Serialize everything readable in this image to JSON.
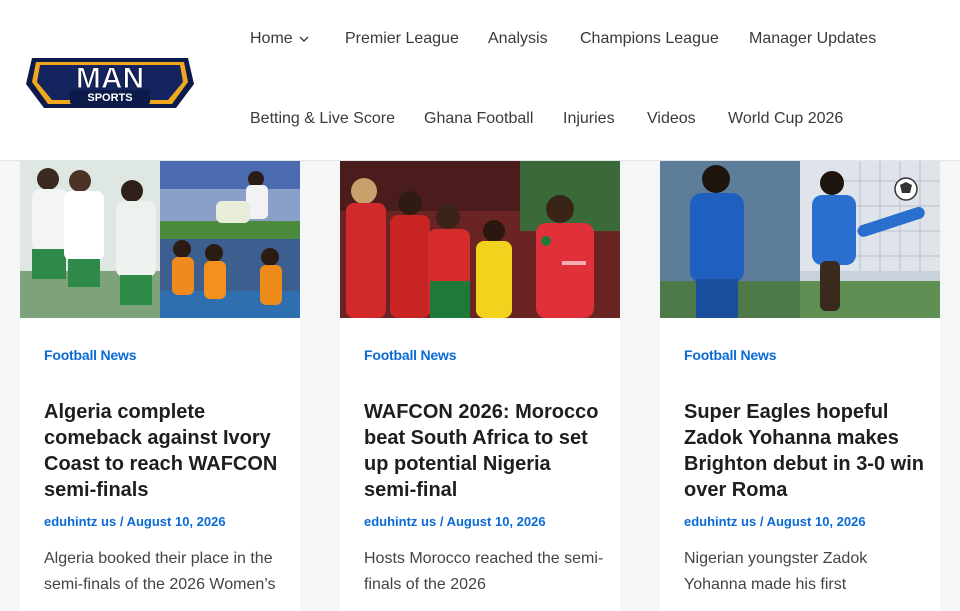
{
  "logo": {
    "main": "MAN",
    "sub": "SPORTS"
  },
  "nav": {
    "home": "Home",
    "premier_league": "Premier League",
    "analysis": "Analysis",
    "champions_league": "Champions League",
    "manager_updates": "Manager Updates",
    "betting": "Betting & Live Score",
    "ghana_football": "Ghana Football",
    "injuries": "Injuries",
    "videos": "Videos",
    "world_cup": "World Cup 2026"
  },
  "colors": {
    "accent": "#0a6bd6",
    "nav_text": "#3a3a3a"
  },
  "posts": [
    {
      "category": "Football News",
      "title": "Algeria complete comeback against Ivory Coast to reach WAFCON semi-finals",
      "author": "eduhintz us",
      "separator": " / ",
      "date": "August 10, 2026",
      "excerpt": "Algeria booked their place in the semi-finals of the 2026 Women’s",
      "image_icon": "football-photo-icon"
    },
    {
      "category": "Football News",
      "title": "WAFCON 2026: Morocco beat South Africa to set up potential Nigeria semi-final",
      "author": "eduhintz us",
      "separator": " / ",
      "date": "August 10, 2026",
      "excerpt": "Hosts Morocco reached the semi-finals of the 2026",
      "image_icon": "football-photo-icon"
    },
    {
      "category": "Football News",
      "title": "Super Eagles hopeful Zadok Yohanna makes Brighton debut in 3-0 win over Roma",
      "author": "eduhintz us",
      "separator": " / ",
      "date": "August 10, 2026",
      "excerpt": "Nigerian youngster Zadok Yohanna made his first",
      "image_icon": "football-photo-icon"
    }
  ]
}
